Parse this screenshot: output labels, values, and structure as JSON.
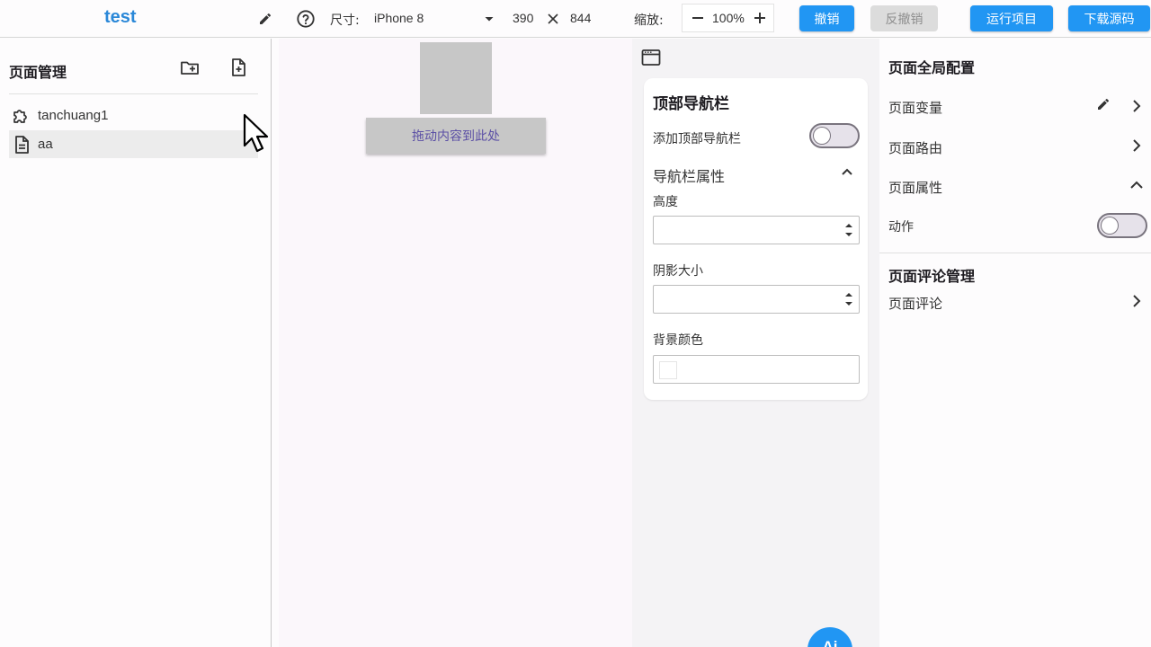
{
  "topbar": {
    "app_title": "test",
    "size_label": "尺寸:",
    "device": "iPhone 8",
    "width": "390",
    "height": "844",
    "zoom_label": "缩放:",
    "zoom_value": "100%",
    "undo": "撤销",
    "redo": "反撤销",
    "run": "运行项目",
    "download": "下载源码"
  },
  "left_panel": {
    "title": "页面管理",
    "pages": [
      {
        "label": "tanchuang1",
        "icon": "puzzle-icon"
      },
      {
        "label": "aa",
        "icon": "document-icon"
      }
    ]
  },
  "canvas": {
    "drop_zone_text": "拖动内容到此处"
  },
  "mid_panel": {
    "card_title": "顶部导航栏",
    "add_nav_label": "添加顶部导航栏",
    "add_nav_enabled": false,
    "nav_props_label": "导航栏属性",
    "height_label": "高度",
    "height_value": "",
    "shadow_label": "阴影大小",
    "shadow_value": "",
    "bg_color_label": "背景颜色",
    "ai_label": "Ai"
  },
  "right_panel": {
    "global_heading": "页面全局配置",
    "page_variables": "页面变量",
    "page_route": "页面路由",
    "page_properties": "页面属性",
    "action_label": "动作",
    "action_enabled": false,
    "comments_heading": "页面评论管理",
    "page_comments": "页面评论"
  },
  "colors": {
    "accent": "#2196f3",
    "title": "#2b88d8",
    "disabled": "#dcdcdc"
  }
}
